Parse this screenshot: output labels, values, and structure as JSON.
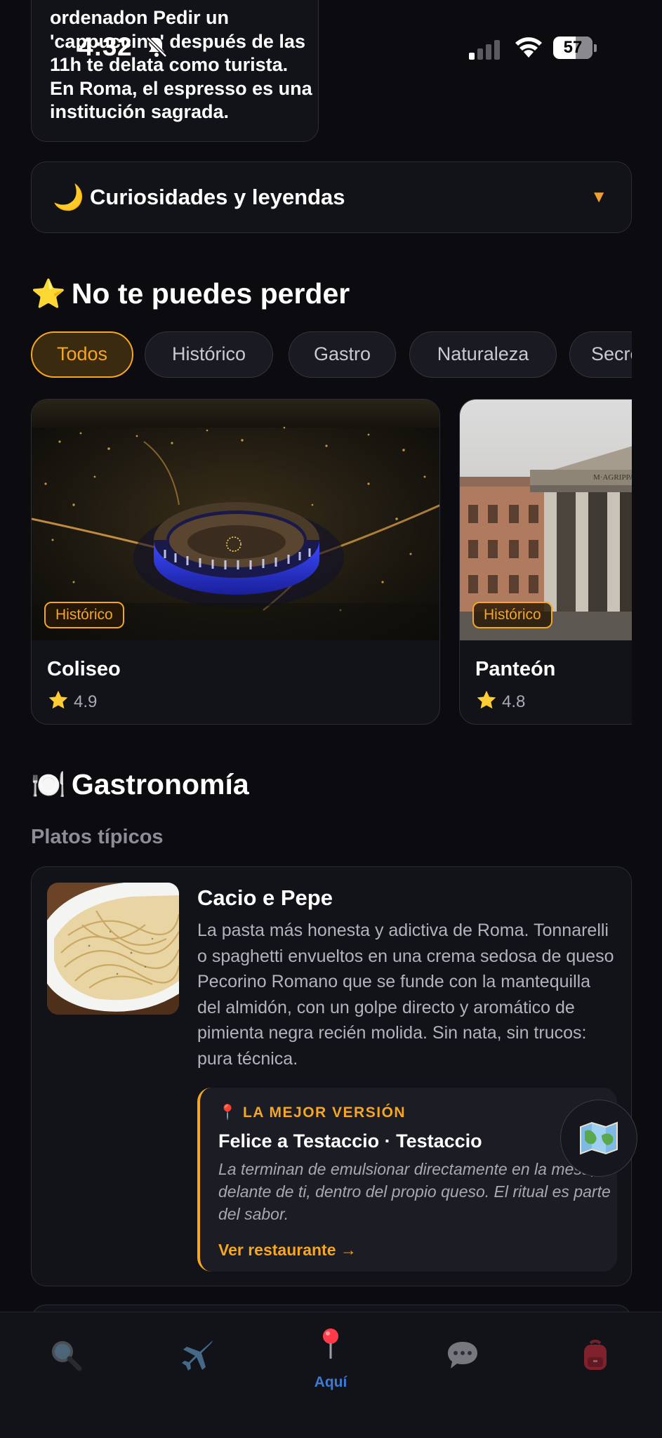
{
  "status_bar": {
    "time": "4:32",
    "battery": "57"
  },
  "tip": {
    "text": "ordenadon Pedir un 'cappuccino' después de las 11h te delata como turista. En Roma, el espresso es una institución sagrada."
  },
  "accordion": {
    "emoji": "🌙",
    "title": "Curiosidades y leyendas",
    "arrow": "▼"
  },
  "must_see": {
    "emoji": "⭐",
    "title": "No te puedes perder",
    "chips": [
      "Todos",
      "Histórico",
      "Gastro",
      "Naturaleza",
      "Secretos"
    ],
    "active_chip": "Todos",
    "places": [
      {
        "name": "Coliseo",
        "category": "Histórico",
        "rating": "4.9"
      },
      {
        "name": "Panteón",
        "category": "Histórico",
        "rating": "4.8"
      }
    ]
  },
  "gastronomy": {
    "emoji": "🍽️",
    "title": "Gastronomía",
    "subtitle": "Platos típicos",
    "dish": {
      "name": "Cacio e Pepe",
      "description": "La pasta más honesta y adictiva de Roma. Tonnarelli o spaghetti envueltos en una crema sedosa de queso Pecorino Romano que se funde con la mantequilla del almidón, con un golpe directo y aromático de pimienta negra recién molida. Sin nata, sin trucos: pura técnica.",
      "best": {
        "label": "📍 LA MEJOR VERSIÓN",
        "name": "Felice a Testaccio · Testaccio",
        "quote": "La terminan de emulsionar directamente en la mesa, delante de ti, dentro del propio queso. El ritual es parte del sabor.",
        "link": "Ver restaurante →"
      }
    }
  },
  "tabbar": {
    "active": "here",
    "tabs": [
      {
        "id": "search",
        "icon": "magnifier-icon",
        "label": ""
      },
      {
        "id": "trips",
        "icon": "airplane-icon",
        "label": ""
      },
      {
        "id": "here",
        "icon": "pin-icon",
        "label": "Aquí"
      },
      {
        "id": "chat",
        "icon": "speech-bubble-icon",
        "label": ""
      },
      {
        "id": "backpack",
        "icon": "backpack-icon",
        "label": ""
      }
    ]
  },
  "colors": {
    "accent": "#f5a623",
    "background": "#0b0b10",
    "card": "#121318",
    "active_tab": "#3d7ad6"
  }
}
